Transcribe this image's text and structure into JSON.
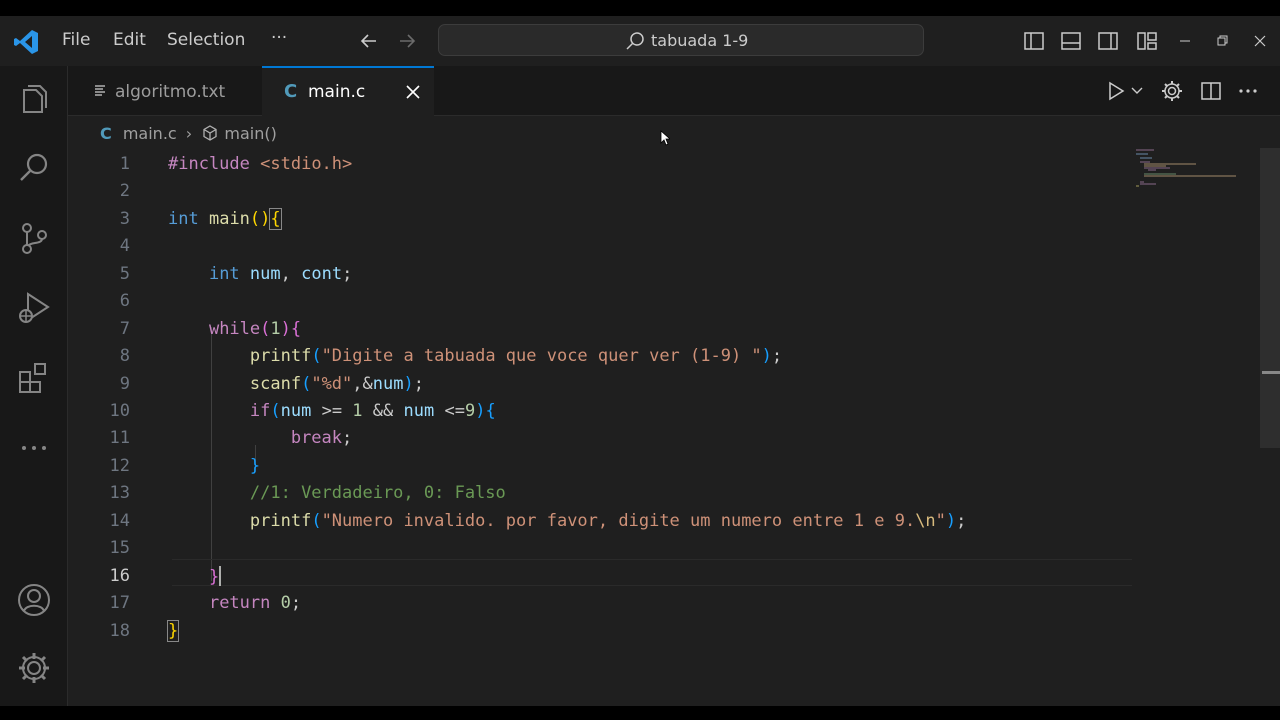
{
  "titlebar": {
    "menus": [
      "File",
      "Edit",
      "Selection",
      "···"
    ],
    "search_text": "tabuada 1-9"
  },
  "tabs": [
    {
      "label": "algoritmo.txt",
      "icon": "text-file-icon"
    },
    {
      "label": "main.c",
      "icon": "c-file-icon",
      "active": true
    }
  ],
  "breadcrumb": {
    "file": "main.c",
    "symbol": "main()"
  },
  "editor": {
    "line_numbers": [
      "1",
      "2",
      "3",
      "4",
      "5",
      "6",
      "7",
      "8",
      "9",
      "10",
      "11",
      "12",
      "13",
      "14",
      "15",
      "16",
      "17",
      "18"
    ],
    "active_line": 16,
    "tokens": {
      "l1_a": "#include",
      "l1_b": "<stdio.h>",
      "l3_a": "int",
      "l3_b": "main",
      "l3_c": "()",
      "l3_d": "{",
      "l5_a": "int",
      "l5_b": "num",
      "l5_c": ", ",
      "l5_d": "cont",
      "l5_e": ";",
      "l7_a": "while",
      "l7_b": "(",
      "l7_c": "1",
      "l7_d": ")",
      "l7_e": "{",
      "l8_a": "printf",
      "l8_b": "(",
      "l8_c": "\"Digite a tabuada que voce quer ver (1-9) \"",
      "l8_d": ")",
      "l8_e": ";",
      "l9_a": "scanf",
      "l9_b": "(",
      "l9_c": "\"%d\"",
      "l9_d": ",&",
      "l9_e": "num",
      "l9_f": ")",
      "l9_g": ";",
      "l10_a": "if",
      "l10_b": "(",
      "l10_c": "num",
      "l10_d": " >= ",
      "l10_e": "1",
      "l10_f": " && ",
      "l10_g": "num",
      "l10_h": " <=",
      "l10_i": "9",
      "l10_j": ")",
      "l10_k": "{",
      "l11_a": "break",
      "l11_b": ";",
      "l12_a": "}",
      "l13_a": "//1: Verdadeiro, 0: Falso",
      "l14_a": "printf",
      "l14_b": "(",
      "l14_c": "\"Numero invalido. por favor, digite um numero entre 1 e 9.",
      "l14_d": "\\n",
      "l14_e": "\"",
      "l14_f": ")",
      "l14_g": ";",
      "l16_a": "}",
      "l17_a": "return",
      "l17_b": "0",
      "l17_c": ";",
      "l18_a": "}"
    }
  },
  "colors": {
    "accent": "#0078d4",
    "background": "#1f1f1f",
    "sidebar": "#181818"
  }
}
